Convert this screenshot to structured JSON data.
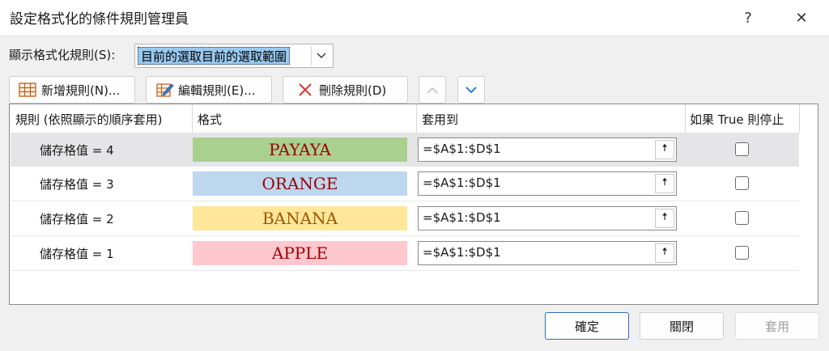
{
  "window": {
    "title": "設定格式化的條件規則管理員",
    "help_glyph": "?",
    "close_glyph": "✕"
  },
  "show_rules": {
    "label": "顯示格式化規則(S):",
    "value": "目前的選取目前的選取範圍"
  },
  "toolbar": {
    "new_rule": "新增規則(N)...",
    "edit_rule": "編輯規則(E)...",
    "delete_rule": "刪除規則(D)"
  },
  "columns": {
    "rule": "規則 (依照顯示的順序套用)",
    "format": "格式",
    "applies_to": "套用到",
    "stop_if_true": "如果 True 則停止"
  },
  "rules": [
    {
      "rule": "儲存格值 = 4",
      "preview": "PAYAYA",
      "fill": "#a9d08e",
      "font_color": "#9c0006",
      "applies_to": "=$A$1:$D$1",
      "stop_if_true": false,
      "selected": true
    },
    {
      "rule": "儲存格值 = 3",
      "preview": "ORANGE",
      "fill": "#bdd7ee",
      "font_color": "#9c0006",
      "applies_to": "=$A$1:$D$1",
      "stop_if_true": false,
      "selected": false
    },
    {
      "rule": "儲存格值 = 2",
      "preview": "BANANA",
      "fill": "#ffe699",
      "font_color": "#9c5700",
      "applies_to": "=$A$1:$D$1",
      "stop_if_true": false,
      "selected": false
    },
    {
      "rule": "儲存格值 = 1",
      "preview": "APPLE",
      "fill": "#ffc7ce",
      "font_color": "#9c0006",
      "applies_to": "=$A$1:$D$1",
      "stop_if_true": false,
      "selected": false
    }
  ],
  "footer": {
    "ok": "確定",
    "close": "關閉",
    "apply": "套用"
  },
  "colors": {
    "accent": "#0078d7",
    "selection_highlight": "#99c9ef",
    "selected_row": "#e5e5e7",
    "disabled_text": "#a0a0a0"
  }
}
